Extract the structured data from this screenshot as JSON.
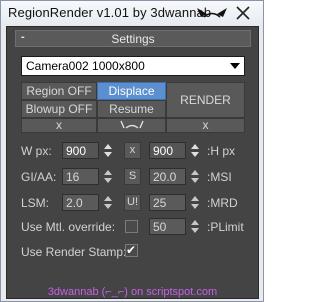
{
  "window": {
    "title": "RegionRender v1.01 by 3dwannab"
  },
  "rollout": {
    "toggle": "-",
    "title": "Settings"
  },
  "camera_select": {
    "value": "Camera002 1000x800"
  },
  "buttons": {
    "region": "Region OFF",
    "displace": "Displace ON",
    "render": "RENDER",
    "blowup": "Blowup OFF",
    "resume": "Resume",
    "x_left": "x",
    "x_right": "x"
  },
  "fields": {
    "w_px": {
      "label": "W px:",
      "value": "900"
    },
    "swap": "x",
    "h_px": {
      "label": ":H px",
      "value": "900"
    },
    "gi_aa": {
      "label": "GI/AA:",
      "value": "16"
    },
    "s_btn": "S",
    "msi": {
      "label": ":MSI",
      "value": "20.0"
    },
    "lsm": {
      "label": "LSM:",
      "value": "2.0"
    },
    "u_btn": "U!",
    "mrd": {
      "label": ":MRD",
      "value": "25"
    },
    "mtl_override": {
      "label": "Use Mtl. override:",
      "checked": false
    },
    "plimit": {
      "label": ":PLimit",
      "value": "50"
    },
    "render_stamp": {
      "label": "Use Render Stamp:",
      "checked": true
    }
  },
  "footer": {
    "link": "3dwannab (⌐_⌐) on scriptspot.com"
  },
  "colors": {
    "accent": "#5b8fd0",
    "panel": "#444444",
    "link": "#c860e8"
  }
}
